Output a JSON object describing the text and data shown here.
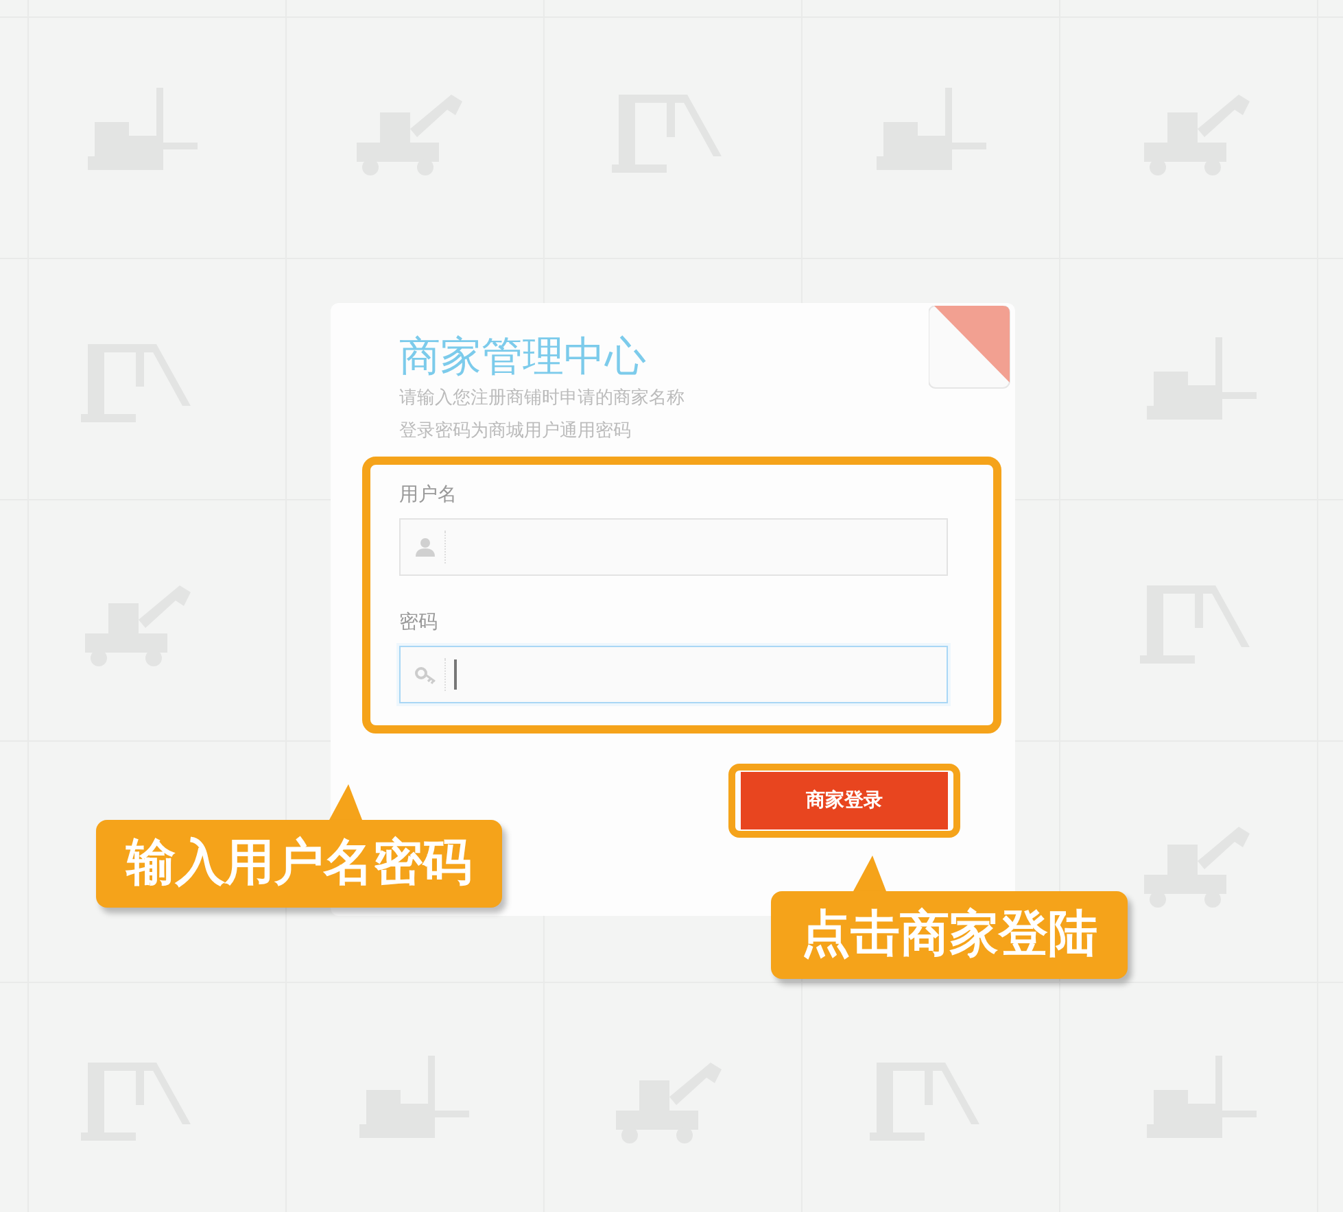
{
  "login_card": {
    "title": "商家管理中心",
    "hints": [
      "请输入您注册商铺时申请的商家名称",
      "登录密码为商城用户通用密码"
    ],
    "fields": [
      {
        "kind": "user",
        "label": "用户名",
        "focused": false
      },
      {
        "kind": "password",
        "label": "密码",
        "focused": true
      }
    ],
    "submit_button": "商家登录"
  },
  "callouts": [
    {
      "text": "输入用户名密码"
    },
    {
      "text": "点击商家登陆"
    }
  ]
}
